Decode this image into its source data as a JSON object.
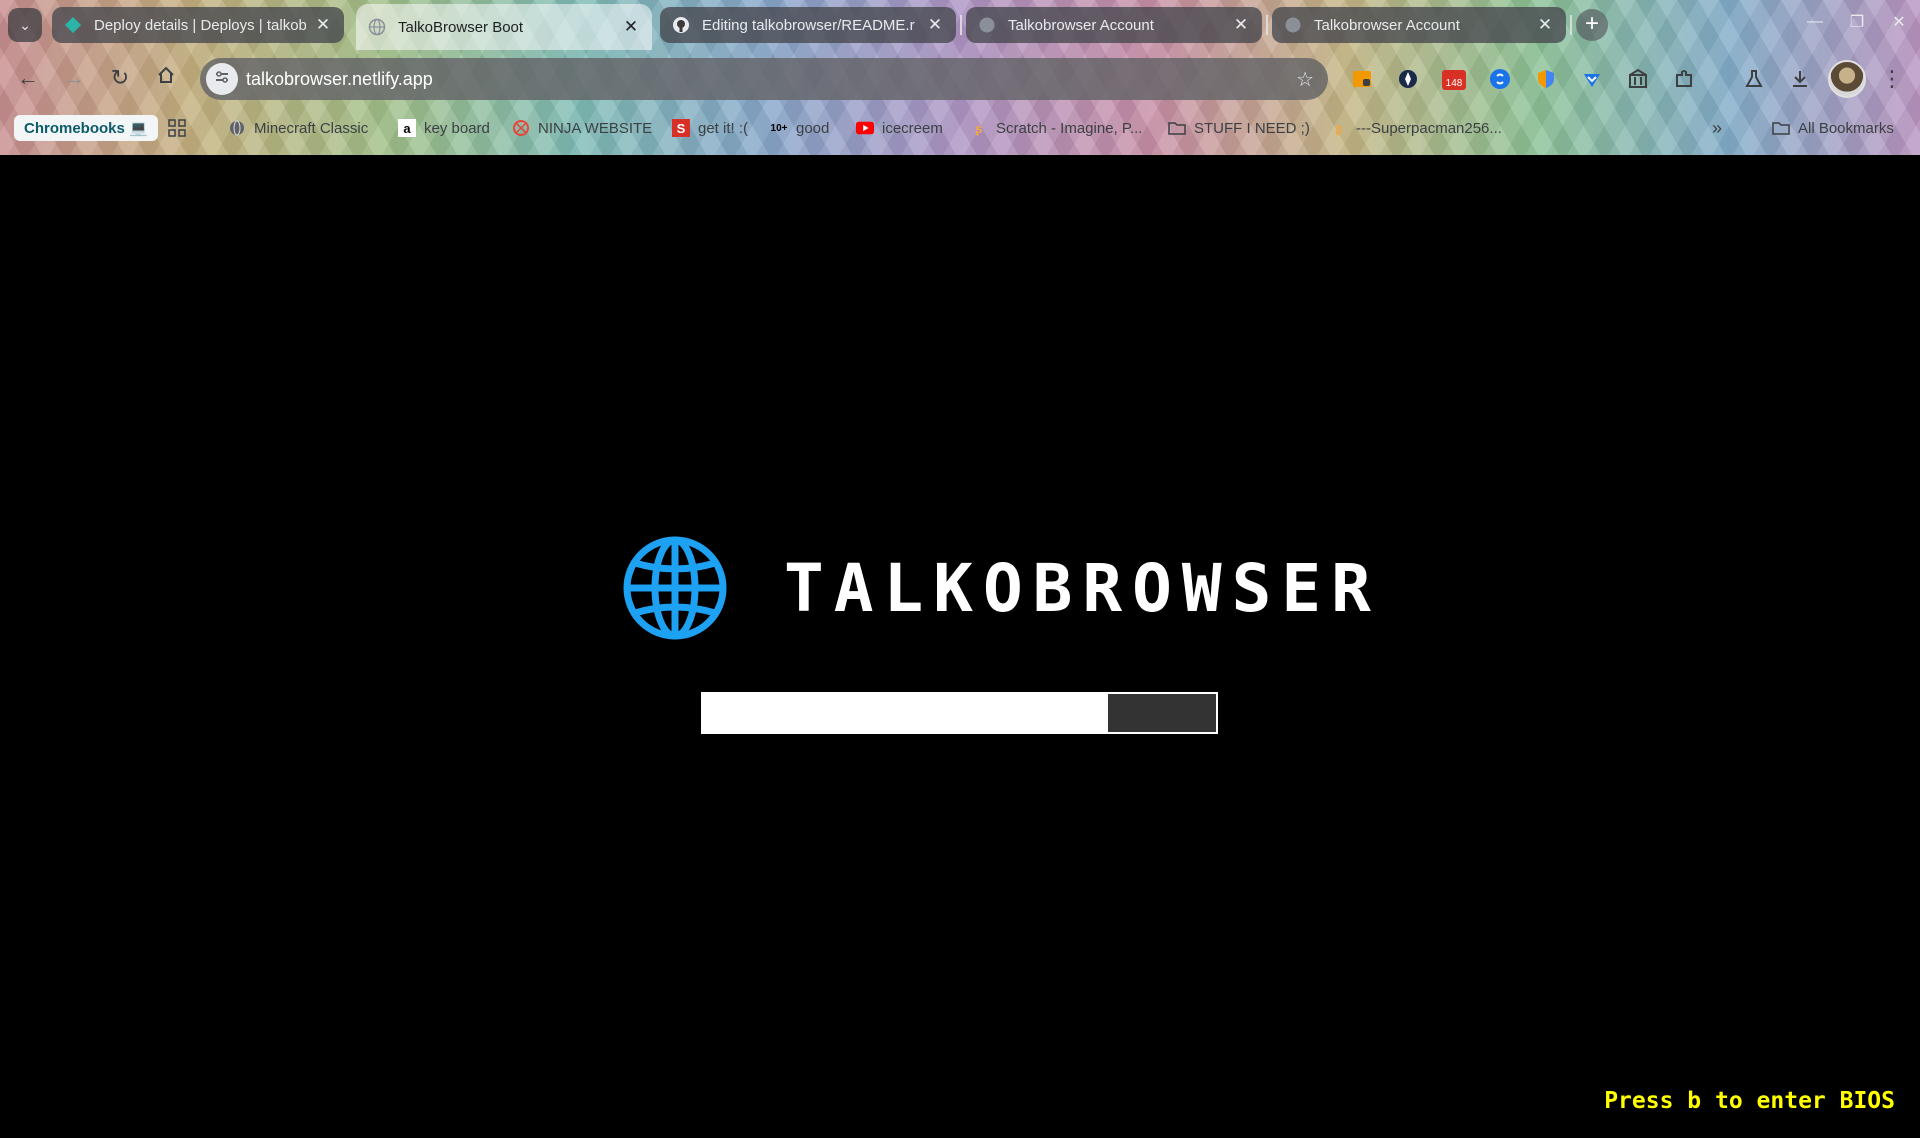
{
  "tabs": [
    {
      "title": "Deploy details | Deploys | talkob",
      "active": false,
      "icon": "netlify-icon"
    },
    {
      "title": "TalkoBrowser Boot",
      "active": true,
      "icon": "globe-icon"
    },
    {
      "title": "Editing talkobrowser/README.r",
      "active": false,
      "icon": "github-icon"
    },
    {
      "title": "Talkobrowser Account",
      "active": false,
      "icon": "globe-icon"
    },
    {
      "title": "Talkobrowser Account",
      "active": false,
      "icon": "globe-icon"
    }
  ],
  "omnibox": {
    "url": "talkobrowser.netlify.app"
  },
  "extensions": {
    "badge_count": "148"
  },
  "bookmarks": {
    "chip": "Chromebooks 💻",
    "items": [
      {
        "label": "Minecraft Classic",
        "icon": "globe-icon"
      },
      {
        "label": "key board",
        "icon": "amazon-icon"
      },
      {
        "label": "NINJA WEBSITE",
        "icon": "ninja-icon"
      },
      {
        "label": "get it! :(",
        "icon": "s-logo-icon"
      },
      {
        "label": "good",
        "icon": "ten-plus-icon"
      },
      {
        "label": "icecreem",
        "icon": "youtube-icon"
      },
      {
        "label": "Scratch - Imagine, P...",
        "icon": "scratch-icon"
      },
      {
        "label": "STUFF I NEED ;)",
        "icon": "folder-icon"
      },
      {
        "label": "---Superpacman256...",
        "icon": "scratch-icon"
      }
    ],
    "all_label": "All Bookmarks"
  },
  "page": {
    "brand": "TALKOBROWSER",
    "progress": 0.79,
    "bios_hint": "Press b to enter BIOS"
  },
  "colors": {
    "page_bg": "#000000",
    "globe": "#1da1f2",
    "bios_hint": "#ffff00",
    "progress_fill": "#ffffff",
    "progress_track": "#333333"
  }
}
